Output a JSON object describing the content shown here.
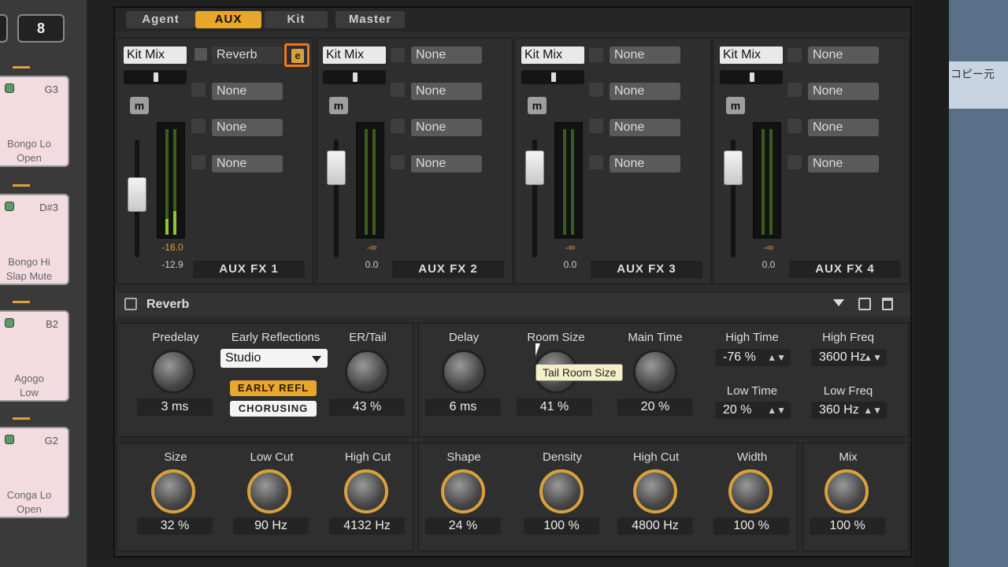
{
  "top_left_button": "8",
  "tabs": [
    {
      "label": "Agent"
    },
    {
      "label": "AUX",
      "active": true
    },
    {
      "label": "Kit"
    },
    {
      "label": "Master"
    }
  ],
  "pads": [
    {
      "note": "G3",
      "name": "Bongo Lo\nOpen"
    },
    {
      "note": "D#3",
      "name": "Bongo Hi\nSlap Mute"
    },
    {
      "note": "B2",
      "name": "Agogo\nLow"
    },
    {
      "note": "G2",
      "name": "Conga Lo\nOpen"
    }
  ],
  "right_strip_text": "コピー元",
  "channels": [
    {
      "input": "Kit Mix",
      "mute": "m",
      "slots": [
        "Reverb",
        "None",
        "None",
        "None"
      ],
      "meter_top": "-16.0",
      "meter_bottom": "-12.9",
      "name": "AUX FX 1"
    },
    {
      "input": "Kit Mix",
      "mute": "m",
      "slots": [
        "None",
        "None",
        "None",
        "None"
      ],
      "meter_top": "-∞",
      "meter_bottom": "0.0",
      "name": "AUX FX 2"
    },
    {
      "input": "Kit Mix",
      "mute": "m",
      "slots": [
        "None",
        "None",
        "None",
        "None"
      ],
      "meter_top": "-∞",
      "meter_bottom": "0.0",
      "name": "AUX FX 3"
    },
    {
      "input": "Kit Mix",
      "mute": "m",
      "slots": [
        "None",
        "None",
        "None",
        "None"
      ],
      "meter_top": "-∞",
      "meter_bottom": "0.0",
      "name": "AUX FX 4"
    }
  ],
  "reverb": {
    "title": "Reverb",
    "predelay": {
      "label": "Predelay",
      "value": "3 ms"
    },
    "early_reflections": {
      "label": "Early Reflections",
      "value": "Studio"
    },
    "er_tail": {
      "label": "ER/Tail",
      "value": "43 %"
    },
    "early_refl_button": "EARLY REFL",
    "chorusing_button": "CHORUSING",
    "delay": {
      "label": "Delay",
      "value": "6 ms"
    },
    "room_size": {
      "label": "Room Size",
      "value": "41 %"
    },
    "tooltip": "Tail Room Size",
    "main_time": {
      "label": "Main Time",
      "value": "20 %"
    },
    "high_time": {
      "label": "High Time",
      "value": "-76 %"
    },
    "high_freq": {
      "label": "High Freq",
      "value": "3600 Hz"
    },
    "low_time": {
      "label": "Low Time",
      "value": "20 %"
    },
    "low_freq": {
      "label": "Low Freq",
      "value": "360 Hz"
    },
    "size": {
      "label": "Size",
      "value": "32 %"
    },
    "low_cut": {
      "label": "Low Cut",
      "value": "90 Hz"
    },
    "high_cut": {
      "label": "High Cut",
      "value": "4132 Hz"
    },
    "shape": {
      "label": "Shape",
      "value": "24 %"
    },
    "density": {
      "label": "Density",
      "value": "100 %"
    },
    "high_cut2": {
      "label": "High Cut",
      "value": "4800 Hz"
    },
    "width": {
      "label": "Width",
      "value": "100 %"
    },
    "mix": {
      "label": "Mix",
      "value": "100 %"
    }
  },
  "colors": {
    "accent": "#e8a62a",
    "pad": "#f2dcdf",
    "highlight": "#f07a1a"
  }
}
